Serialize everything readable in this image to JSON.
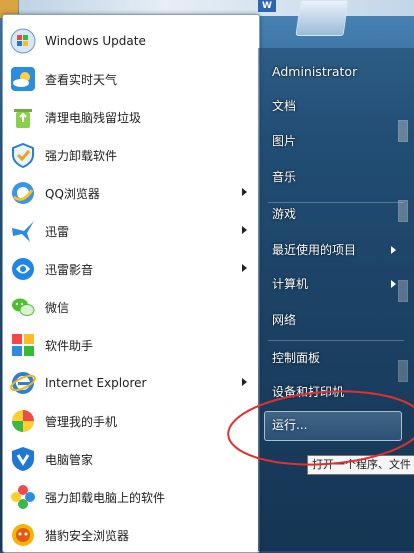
{
  "left_menu": {
    "items": [
      {
        "label": "Windows Update",
        "icon": "windows-update-icon",
        "submenu": false
      },
      {
        "label": "查看实时天气",
        "icon": "weather-icon",
        "submenu": false
      },
      {
        "label": "清理电脑残留垃圾",
        "icon": "recycle-bin-icon",
        "submenu": false
      },
      {
        "label": "强力卸载软件",
        "icon": "shield-uninstall-icon",
        "submenu": false
      },
      {
        "label": "QQ浏览器",
        "icon": "qq-browser-icon",
        "submenu": true
      },
      {
        "label": "迅雷",
        "icon": "thunder-bird-icon",
        "submenu": true
      },
      {
        "label": "迅雷影音",
        "icon": "thunder-player-icon",
        "submenu": true
      },
      {
        "label": "微信",
        "icon": "wechat-icon",
        "submenu": false
      },
      {
        "label": "软件助手",
        "icon": "software-helper-icon",
        "submenu": false
      },
      {
        "label": "Internet Explorer",
        "icon": "internet-explorer-icon",
        "submenu": true
      },
      {
        "label": "管理我的手机",
        "icon": "phone-manager-icon",
        "submenu": false
      },
      {
        "label": "电脑管家",
        "icon": "pc-manager-shield-icon",
        "submenu": false
      },
      {
        "label": "强力卸载电脑上的软件",
        "icon": "uninstall-flower-icon",
        "submenu": false
      },
      {
        "label": "猎豹安全浏览器",
        "icon": "cheetah-browser-icon",
        "submenu": false
      }
    ]
  },
  "right_menu": {
    "user": "Administrator",
    "items": [
      {
        "label": "文档",
        "submenu": false
      },
      {
        "label": "图片",
        "submenu": false
      },
      {
        "label": "音乐",
        "submenu": false
      },
      {
        "label": "游戏",
        "submenu": false
      },
      {
        "label": "最近使用的项目",
        "submenu": true
      },
      {
        "label": "计算机",
        "submenu": true
      },
      {
        "label": "网络",
        "submenu": false
      },
      {
        "label": "控制面板",
        "submenu": false
      },
      {
        "label": "设备和打印机",
        "submenu": false
      }
    ],
    "run": "运行...",
    "run_tooltip": "打开一个程序、文件"
  },
  "colors": {
    "annotation": "#e03030",
    "accent": "#1f4f7a"
  }
}
